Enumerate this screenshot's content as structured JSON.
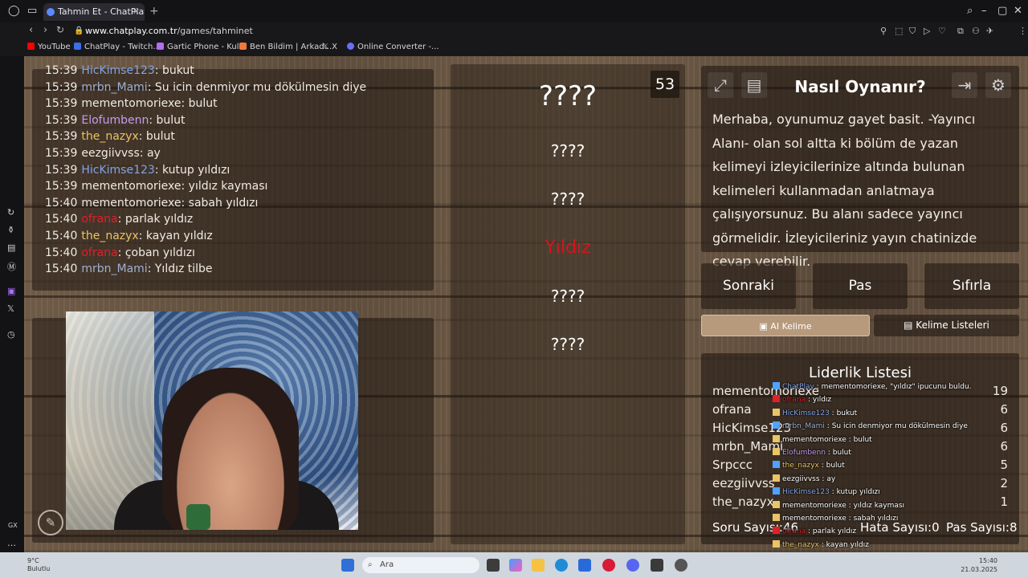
{
  "browser": {
    "tab_title": "Tahmin Et - ChatPlay",
    "url_domain": "www.chatplay.com.tr",
    "url_path": "/games/tahminet",
    "bookmarks": [
      "YouTube",
      "ChatPlay - Twitch...",
      "Gartic Phone - Kul...",
      "Ben Bildim | Arkad...",
      "X",
      "Online Converter -..."
    ]
  },
  "chat": {
    "lines": [
      {
        "time": "15:39",
        "user": "HicKimse123",
        "msg": "bukut",
        "color": "#7fa4e8"
      },
      {
        "time": "15:39",
        "user": "mrbn_Mami",
        "msg": "Su icin denmiyor mu dökülmesin diye",
        "color": "#9fb0d0"
      },
      {
        "time": "15:39",
        "user": "mementomoriexe",
        "msg": "bulut",
        "color": "#f0ebe4"
      },
      {
        "time": "15:39",
        "user": "Elofumbenn",
        "msg": "bulut",
        "color": "#c59cf2"
      },
      {
        "time": "15:39",
        "user": "the_nazyx",
        "msg": "bulut",
        "color": "#e9c567"
      },
      {
        "time": "15:39",
        "user": "eezgiivvss",
        "msg": "ay",
        "color": "#f0ebe4"
      },
      {
        "time": "15:39",
        "user": "HicKimse123",
        "msg": "kutup yıldızı",
        "color": "#7fa4e8"
      },
      {
        "time": "15:39",
        "user": "mementomoriexe",
        "msg": "yıldız kayması",
        "color": "#f0ebe4"
      },
      {
        "time": "15:40",
        "user": "mementomoriexe",
        "msg": "sabah yıldızı",
        "color": "#f0ebe4"
      },
      {
        "time": "15:40",
        "user": "ofrana",
        "msg": "parlak yıldız",
        "color": "#e0202a"
      },
      {
        "time": "15:40",
        "user": "the_nazyx",
        "msg": "kayan yıldız",
        "color": "#e9c567"
      },
      {
        "time": "15:40",
        "user": "ofrana",
        "msg": "çoban yıldızı",
        "color": "#e0202a"
      },
      {
        "time": "15:40",
        "user": "mrbn_Mami",
        "msg": "Yıldız tilbe",
        "color": "#9fb0d0"
      }
    ]
  },
  "game": {
    "timer": "53",
    "words": [
      {
        "text": "????",
        "color": "#ffffff",
        "size": 34
      },
      {
        "text": "????",
        "color": "#ffffff",
        "size": 20
      },
      {
        "text": "????",
        "color": "#ffffff",
        "size": 20
      },
      {
        "text": "Yıldız",
        "color": "#d4151f",
        "size": 22
      },
      {
        "text": "????",
        "color": "#ffffff",
        "size": 20
      },
      {
        "text": "????",
        "color": "#ffffff",
        "size": 20
      }
    ]
  },
  "howto": {
    "title": "Nasıl Oynanır?",
    "body": "Merhaba, oyunumuz gayet basit. -Yayıncı Alanı- olan sol altta ki bölüm de yazan kelimeyi izleyicilerinize altında bulunan kelimeleri kullanmadan anlatmaya çalışıyorsunuz. Bu alanı sadece yayıncı görmelidir. İzleyicileriniz yayın chatinizde cevap verebilir."
  },
  "buttons": {
    "next": "Sonraki",
    "pass": "Pas",
    "reset": "Sıfırla",
    "ai_word": "AI Kelime",
    "word_lists": "Kelime Listeleri"
  },
  "leaderboard": {
    "title": "Liderlik Listesi",
    "rows": [
      {
        "name": "mementomoriexe",
        "score": "19"
      },
      {
        "name": "ofrana",
        "score": "6"
      },
      {
        "name": "HicKimse123",
        "score": "6"
      },
      {
        "name": "mrbn_Mami",
        "score": "6"
      },
      {
        "name": "Srpccc",
        "score": "5"
      },
      {
        "name": "eezgiivvss",
        "score": "2"
      },
      {
        "name": "the_nazyx",
        "score": "1"
      }
    ],
    "soru_label": "Soru Sayısı:",
    "soru_value": "46",
    "hata_label": "Hata Sayısı:",
    "hata_value": "0",
    "pas_label": "Pas Sayısı:",
    "pas_value": "8"
  },
  "overlay_chat": [
    {
      "user": "ChatPlay",
      "msg": "mementomoriexe, \"yıldız\" ipucunu buldu.",
      "color": "#7fa4e8"
    },
    {
      "user": "ofrana",
      "msg": "yıldız",
      "color": "#e0202a"
    },
    {
      "user": "HicKimse123",
      "msg": "bukut",
      "color": "#7fa4e8"
    },
    {
      "user": "mrbn_Mami",
      "msg": "Su icin denmiyor mu dökülmesin diye",
      "color": "#9fb0d0"
    },
    {
      "user": "mementomoriexe",
      "msg": "bulut",
      "color": "#ffffff"
    },
    {
      "user": "Elofumbenn",
      "msg": "bulut",
      "color": "#c59cf2"
    },
    {
      "user": "the_nazyx",
      "msg": "bulut",
      "color": "#e9c567"
    },
    {
      "user": "eezgiivvss",
      "msg": "ay",
      "color": "#ffffff"
    },
    {
      "user": "HicKimse123",
      "msg": "kutup yıldızı",
      "color": "#7fa4e8"
    },
    {
      "user": "mementomoriexe",
      "msg": "yıldız kayması",
      "color": "#ffffff"
    },
    {
      "user": "mementomoriexe",
      "msg": "sabah yıldızı",
      "color": "#ffffff"
    },
    {
      "user": "ofrana",
      "msg": "parlak yıldız",
      "color": "#e0202a"
    },
    {
      "user": "the_nazyx",
      "msg": "kayan yıldız",
      "color": "#e9c567"
    },
    {
      "user": "ofrana",
      "msg": "çoban yıldızı",
      "color": "#e0202a"
    },
    {
      "user": "mrbn_Mami",
      "msg": "Yıldız tilbe",
      "color": "#9fb0d0"
    }
  ],
  "taskbar": {
    "weather_temp": "9°C",
    "weather_desc": "Bulutlu",
    "search_placeholder": "Ara",
    "time": "15:40",
    "date": "21.03.2025"
  },
  "icons": [
    "opera-logo",
    "search-icon",
    "minimize-icon",
    "maximize-icon",
    "close-icon",
    "back-icon",
    "forward-icon",
    "reload-icon",
    "lock-icon",
    "expand-icon",
    "notes-icon",
    "exit-icon",
    "settings-icon",
    "pen-icon",
    "windows-start-icon"
  ]
}
